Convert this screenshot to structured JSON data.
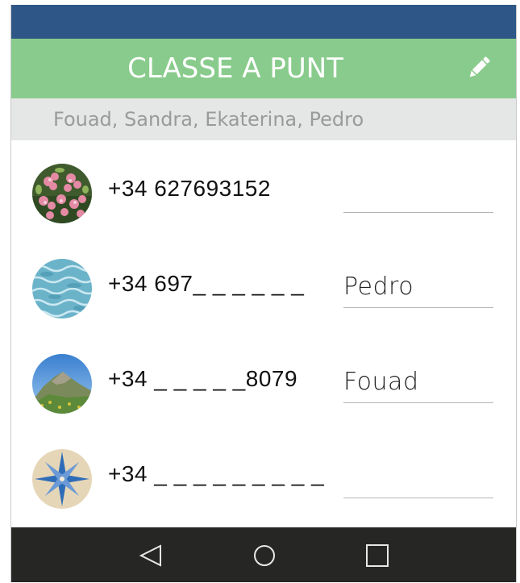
{
  "header": {
    "title": "CLASSE A PUNT",
    "edit_icon": "pencil-icon"
  },
  "members": {
    "text": "Fouad, Sandra, Ekaterina, Pedro"
  },
  "contacts": [
    {
      "avatar": "flowers-photo",
      "phone": "+34 627693152",
      "name": ""
    },
    {
      "avatar": "water-photo",
      "phone": "+34 697_ _ _ _ _ _",
      "name": "Pedro"
    },
    {
      "avatar": "mountain-photo",
      "phone": "+34 _ _ _ _ _8079",
      "name": "Fouad"
    },
    {
      "avatar": "compass-rose-photo",
      "phone": "+34 _ _ _ _ _ _ _ _ _",
      "name": ""
    }
  ],
  "nav": {
    "back_icon": "back-triangle-icon",
    "home_icon": "home-circle-icon",
    "recents_icon": "recents-square-icon"
  },
  "colors": {
    "status_bar": "#2e5686",
    "header": "#89cb8c",
    "members_bar": "#e5e6e6",
    "nav_bar": "#262625"
  }
}
